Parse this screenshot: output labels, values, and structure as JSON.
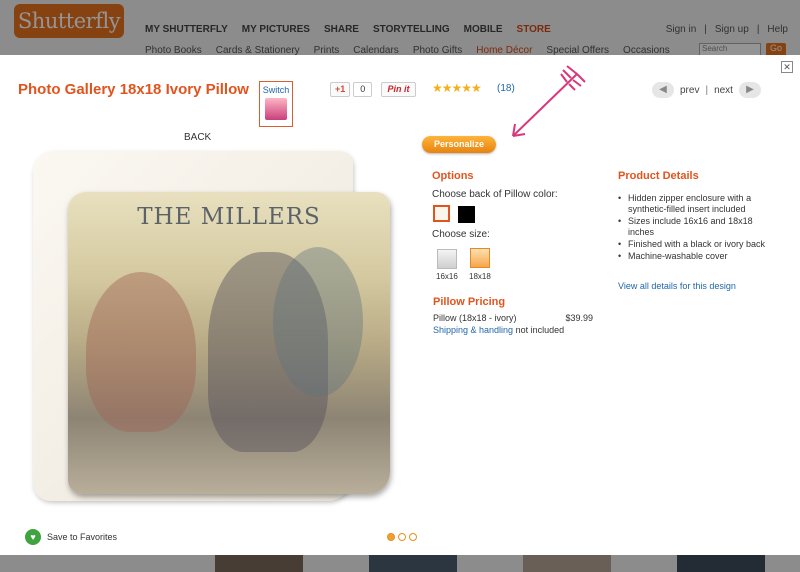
{
  "site": {
    "logo": "Shutterfly",
    "nav": [
      "MY SHUTTERFLY",
      "MY PICTURES",
      "SHARE",
      "STORYTELLING",
      "MOBILE",
      "STORE"
    ],
    "subnav": [
      "Photo Books",
      "Cards & Stationery",
      "Prints",
      "Calendars",
      "Photo Gifts",
      "Home Décor",
      "Special Offers",
      "Occasions"
    ],
    "account": [
      "Sign in",
      "|",
      "Sign up",
      "|",
      "Help"
    ],
    "search_placeholder": "Search",
    "go_label": "Go"
  },
  "modal": {
    "close_glyph": "✕",
    "title": "Photo Gallery 18x18 Ivory Pillow",
    "switch_label": "Switch",
    "gplus_label": "+1",
    "gplus_count": "0",
    "pinit_label": "Pin it",
    "stars": "★★★★★",
    "review_count": "(18)",
    "prev_label": "prev",
    "next_label": "next",
    "separator": "|",
    "back_label": "BACK",
    "pillow_text": "THE MILLERS",
    "personalize_label": "Personalize",
    "options": {
      "heading": "Options",
      "back_color_label": "Choose back of Pillow color:",
      "colors": [
        "#fbf6ec",
        "#000000"
      ],
      "size_label": "Choose size:",
      "sizes": [
        "16x16",
        "18x18"
      ]
    },
    "pricing": {
      "heading": "Pillow Pricing",
      "item": "Pillow (18x18 - ivory)",
      "price": "$39.99",
      "shipping_link": "Shipping & handling",
      "shipping_note": " not included"
    },
    "details": {
      "heading": "Product Details",
      "items": [
        "Hidden zipper enclosure with a synthetic-filled insert included",
        "Sizes include 16x16 and 18x18 inches",
        "Finished with a black or ivory back",
        "Machine-washable cover"
      ],
      "link": "View all details for this design"
    },
    "favorites_label": "Save to Favorites",
    "accent_color": "#e2541e",
    "link_color": "#2266aa"
  }
}
